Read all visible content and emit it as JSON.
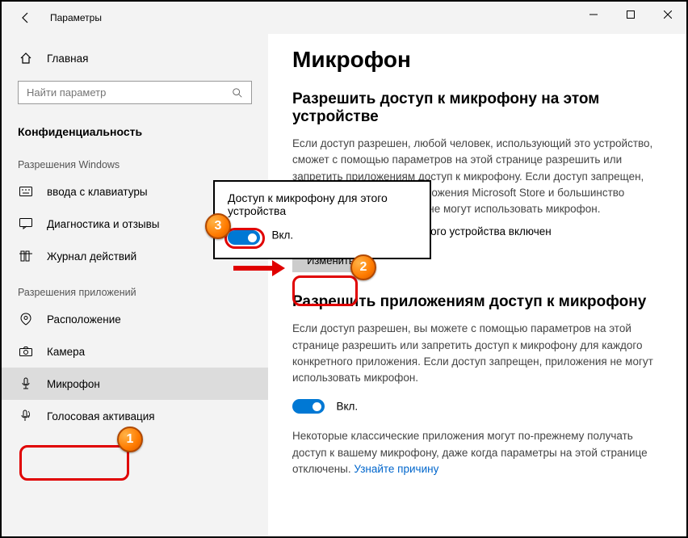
{
  "titlebar": {
    "title": "Параметры"
  },
  "sidebar": {
    "home": "Главная",
    "search_placeholder": "Найти параметр",
    "section": "Конфиденциальность",
    "sub_windows": "Разрешения Windows",
    "items_win": [
      {
        "label": "ввода с клавиатуры"
      },
      {
        "label": "Диагностика и отзывы"
      },
      {
        "label": "Журнал действий"
      }
    ],
    "sub_apps": "Разрешения приложений",
    "items_app": [
      {
        "label": "Расположение"
      },
      {
        "label": "Камера"
      },
      {
        "label": "Микрофон"
      },
      {
        "label": "Голосовая активация"
      }
    ]
  },
  "content": {
    "h1": "Микрофон",
    "sec1_title": "Разрешить доступ к микрофону на этом устройстве",
    "sec1_desc": "Если доступ разрешен, любой человек, использующий это устройство, сможет с помощью параметров на этой странице разрешить или запретить приложениям доступ к микрофону. Если доступ запрещен, компоненты Windows, приложения Microsoft Store и большинство классических приложений не могут использовать микрофон.",
    "sec1_status": "Доступ к микрофону для этого устройства включен",
    "change_btn": "Изменить",
    "sec2_title": "Разрешить приложениям доступ к микрофону",
    "sec2_desc": "Если доступ разрешен, вы можете с помощью параметров на этой странице разрешить или запретить доступ к микрофону для каждого конкретного приложения. Если доступ запрещен, приложения не могут использовать микрофон.",
    "toggle_on": "Вкл.",
    "sec2_note": "Некоторые классические приложения могут по-прежнему получать доступ к вашему микрофону, даже когда параметры на этой странице отключены.",
    "link": "Узнайте причину"
  },
  "popup": {
    "title": "Доступ к микрофону для этого устройства",
    "state": "Вкл."
  },
  "annotations": {
    "b1": "1",
    "b2": "2",
    "b3": "3"
  }
}
